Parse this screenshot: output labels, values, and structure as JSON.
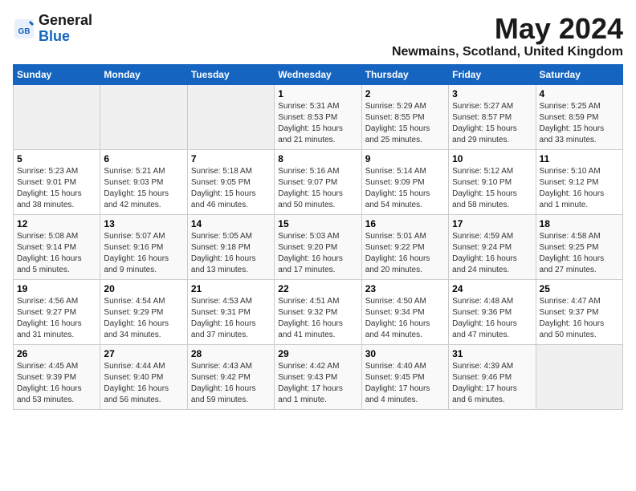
{
  "header": {
    "logo_general": "General",
    "logo_blue": "Blue",
    "month_title": "May 2024",
    "location": "Newmains, Scotland, United Kingdom"
  },
  "weekdays": [
    "Sunday",
    "Monday",
    "Tuesday",
    "Wednesday",
    "Thursday",
    "Friday",
    "Saturday"
  ],
  "weeks": [
    [
      {
        "num": "",
        "info": ""
      },
      {
        "num": "",
        "info": ""
      },
      {
        "num": "",
        "info": ""
      },
      {
        "num": "1",
        "info": "Sunrise: 5:31 AM\nSunset: 8:53 PM\nDaylight: 15 hours and 21 minutes."
      },
      {
        "num": "2",
        "info": "Sunrise: 5:29 AM\nSunset: 8:55 PM\nDaylight: 15 hours and 25 minutes."
      },
      {
        "num": "3",
        "info": "Sunrise: 5:27 AM\nSunset: 8:57 PM\nDaylight: 15 hours and 29 minutes."
      },
      {
        "num": "4",
        "info": "Sunrise: 5:25 AM\nSunset: 8:59 PM\nDaylight: 15 hours and 33 minutes."
      }
    ],
    [
      {
        "num": "5",
        "info": "Sunrise: 5:23 AM\nSunset: 9:01 PM\nDaylight: 15 hours and 38 minutes."
      },
      {
        "num": "6",
        "info": "Sunrise: 5:21 AM\nSunset: 9:03 PM\nDaylight: 15 hours and 42 minutes."
      },
      {
        "num": "7",
        "info": "Sunrise: 5:18 AM\nSunset: 9:05 PM\nDaylight: 15 hours and 46 minutes."
      },
      {
        "num": "8",
        "info": "Sunrise: 5:16 AM\nSunset: 9:07 PM\nDaylight: 15 hours and 50 minutes."
      },
      {
        "num": "9",
        "info": "Sunrise: 5:14 AM\nSunset: 9:09 PM\nDaylight: 15 hours and 54 minutes."
      },
      {
        "num": "10",
        "info": "Sunrise: 5:12 AM\nSunset: 9:10 PM\nDaylight: 15 hours and 58 minutes."
      },
      {
        "num": "11",
        "info": "Sunrise: 5:10 AM\nSunset: 9:12 PM\nDaylight: 16 hours and 1 minute."
      }
    ],
    [
      {
        "num": "12",
        "info": "Sunrise: 5:08 AM\nSunset: 9:14 PM\nDaylight: 16 hours and 5 minutes."
      },
      {
        "num": "13",
        "info": "Sunrise: 5:07 AM\nSunset: 9:16 PM\nDaylight: 16 hours and 9 minutes."
      },
      {
        "num": "14",
        "info": "Sunrise: 5:05 AM\nSunset: 9:18 PM\nDaylight: 16 hours and 13 minutes."
      },
      {
        "num": "15",
        "info": "Sunrise: 5:03 AM\nSunset: 9:20 PM\nDaylight: 16 hours and 17 minutes."
      },
      {
        "num": "16",
        "info": "Sunrise: 5:01 AM\nSunset: 9:22 PM\nDaylight: 16 hours and 20 minutes."
      },
      {
        "num": "17",
        "info": "Sunrise: 4:59 AM\nSunset: 9:24 PM\nDaylight: 16 hours and 24 minutes."
      },
      {
        "num": "18",
        "info": "Sunrise: 4:58 AM\nSunset: 9:25 PM\nDaylight: 16 hours and 27 minutes."
      }
    ],
    [
      {
        "num": "19",
        "info": "Sunrise: 4:56 AM\nSunset: 9:27 PM\nDaylight: 16 hours and 31 minutes."
      },
      {
        "num": "20",
        "info": "Sunrise: 4:54 AM\nSunset: 9:29 PM\nDaylight: 16 hours and 34 minutes."
      },
      {
        "num": "21",
        "info": "Sunrise: 4:53 AM\nSunset: 9:31 PM\nDaylight: 16 hours and 37 minutes."
      },
      {
        "num": "22",
        "info": "Sunrise: 4:51 AM\nSunset: 9:32 PM\nDaylight: 16 hours and 41 minutes."
      },
      {
        "num": "23",
        "info": "Sunrise: 4:50 AM\nSunset: 9:34 PM\nDaylight: 16 hours and 44 minutes."
      },
      {
        "num": "24",
        "info": "Sunrise: 4:48 AM\nSunset: 9:36 PM\nDaylight: 16 hours and 47 minutes."
      },
      {
        "num": "25",
        "info": "Sunrise: 4:47 AM\nSunset: 9:37 PM\nDaylight: 16 hours and 50 minutes."
      }
    ],
    [
      {
        "num": "26",
        "info": "Sunrise: 4:45 AM\nSunset: 9:39 PM\nDaylight: 16 hours and 53 minutes."
      },
      {
        "num": "27",
        "info": "Sunrise: 4:44 AM\nSunset: 9:40 PM\nDaylight: 16 hours and 56 minutes."
      },
      {
        "num": "28",
        "info": "Sunrise: 4:43 AM\nSunset: 9:42 PM\nDaylight: 16 hours and 59 minutes."
      },
      {
        "num": "29",
        "info": "Sunrise: 4:42 AM\nSunset: 9:43 PM\nDaylight: 17 hours and 1 minute."
      },
      {
        "num": "30",
        "info": "Sunrise: 4:40 AM\nSunset: 9:45 PM\nDaylight: 17 hours and 4 minutes."
      },
      {
        "num": "31",
        "info": "Sunrise: 4:39 AM\nSunset: 9:46 PM\nDaylight: 17 hours and 6 minutes."
      },
      {
        "num": "",
        "info": ""
      }
    ]
  ]
}
